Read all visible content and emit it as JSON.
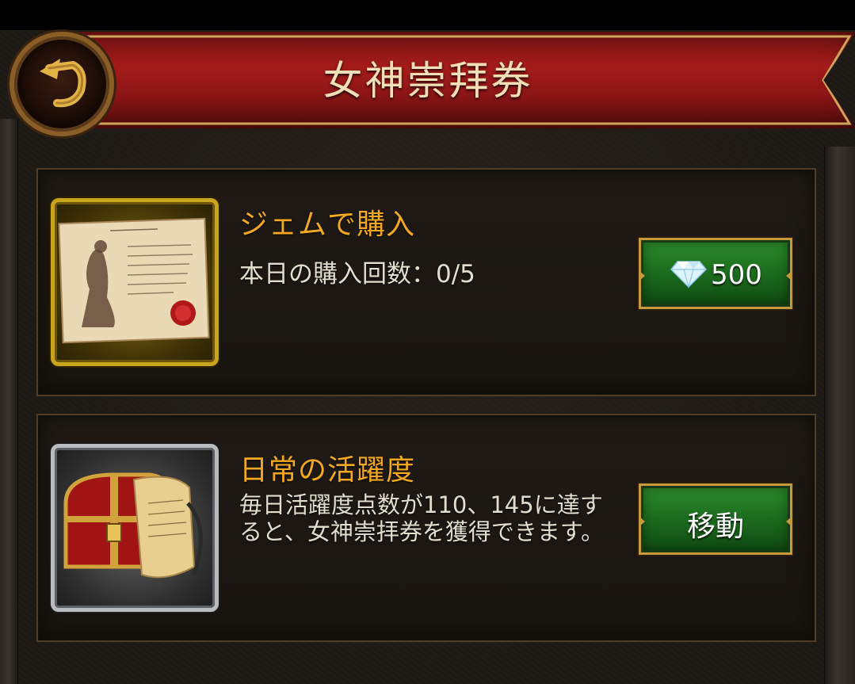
{
  "header": {
    "title": "女神崇拜券",
    "back_icon": "back-arrow-icon"
  },
  "gem_purchase": {
    "title": "ジェムで購入",
    "daily_limit_text": "本日の購入回数：0/5",
    "price": "500",
    "price_icon": "diamond-icon",
    "item_icon": "worship-ticket-icon"
  },
  "daily_activity": {
    "title": "日常の活躍度",
    "description": "毎日活躍度点数が110、145に達すると、女神崇拝券を獲得できます。",
    "button_label": "移動",
    "item_icon": "treasure-chest-icon"
  },
  "colors": {
    "banner_red": "#a51c1a",
    "accent_gold": "#f3a81f",
    "button_green": "#1c6b1e",
    "text_light": "#e4dccd"
  }
}
